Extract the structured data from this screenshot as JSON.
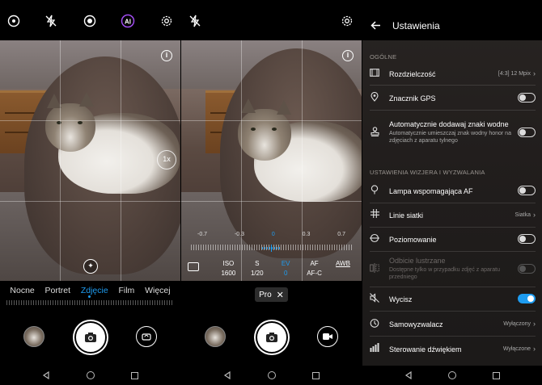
{
  "photo_panel": {
    "top_icons": [
      "flash-auto-icon",
      "flash-off-icon",
      "live-photo-icon",
      "ai-icon",
      "settings-gear-icon"
    ],
    "ai_label": "AI",
    "zoom_label": "1x",
    "info_label": "i",
    "modes": [
      {
        "label": "Nocne"
      },
      {
        "label": "Portret"
      },
      {
        "label": "Zdjęcie"
      },
      {
        "label": "Film"
      },
      {
        "label": "Więcej"
      }
    ],
    "active_mode": "Zdjęcie"
  },
  "pro_panel": {
    "info_label": "i",
    "ev_scale": [
      "-0.7",
      "-0.3",
      "0",
      "0.3",
      "0.7"
    ],
    "params": [
      {
        "key": "ISO",
        "value": "1600"
      },
      {
        "key": "S",
        "value": "1/20"
      },
      {
        "key": "EV",
        "value": "0"
      },
      {
        "key": "AF",
        "value": "AF-C"
      },
      {
        "key": "AWB",
        "value": ""
      }
    ],
    "active_param": "EV",
    "mode_tag": "Pro",
    "mode_tag_close": "✕"
  },
  "settings_panel": {
    "title": "Ustawienia",
    "sections": [
      {
        "title": "OGÓLNE",
        "rows": [
          {
            "icon": "resolution-icon",
            "title": "Rozdzielczość",
            "value": "[4:3] 12 Mpix",
            "control": "chevron"
          },
          {
            "icon": "gps-pin-icon",
            "title": "Znacznik GPS",
            "control": "toggle",
            "state": "off"
          },
          {
            "icon": "watermark-stamp-icon",
            "title": "Automatycznie dodawaj znaki wodne",
            "subtitle": "Automatycznie umieszczaj znak wodny honor na zdjęciach z aparatu tylnego",
            "control": "toggle",
            "state": "off"
          }
        ]
      },
      {
        "title": "USTAWIENIA WIZJERA I WYZWALANIA",
        "rows": [
          {
            "icon": "af-lamp-icon",
            "title": "Lampa wspomagająca AF",
            "control": "toggle",
            "state": "off"
          },
          {
            "icon": "grid-icon",
            "title": "Linie siatki",
            "value": "Siatka",
            "control": "chevron"
          },
          {
            "icon": "level-icon",
            "title": "Poziomowanie",
            "control": "toggle",
            "state": "off"
          },
          {
            "icon": "mirror-icon",
            "title": "Odbicie lustrzane",
            "subtitle": "Dostępne tylko w przypadku zdjęć z aparatu przedniego",
            "control": "toggle",
            "state": "disabled"
          },
          {
            "icon": "mute-icon",
            "title": "Wycisz",
            "control": "toggle",
            "state": "on"
          },
          {
            "icon": "timer-icon",
            "title": "Samowyzwalacz",
            "value": "Wyłączony",
            "control": "chevron"
          },
          {
            "icon": "audio-control-icon",
            "title": "Sterowanie dźwiękiem",
            "value": "Wyłączone",
            "control": "chevron"
          }
        ]
      }
    ]
  },
  "colors": {
    "accent": "#1e9cf0",
    "background": "#000000"
  }
}
